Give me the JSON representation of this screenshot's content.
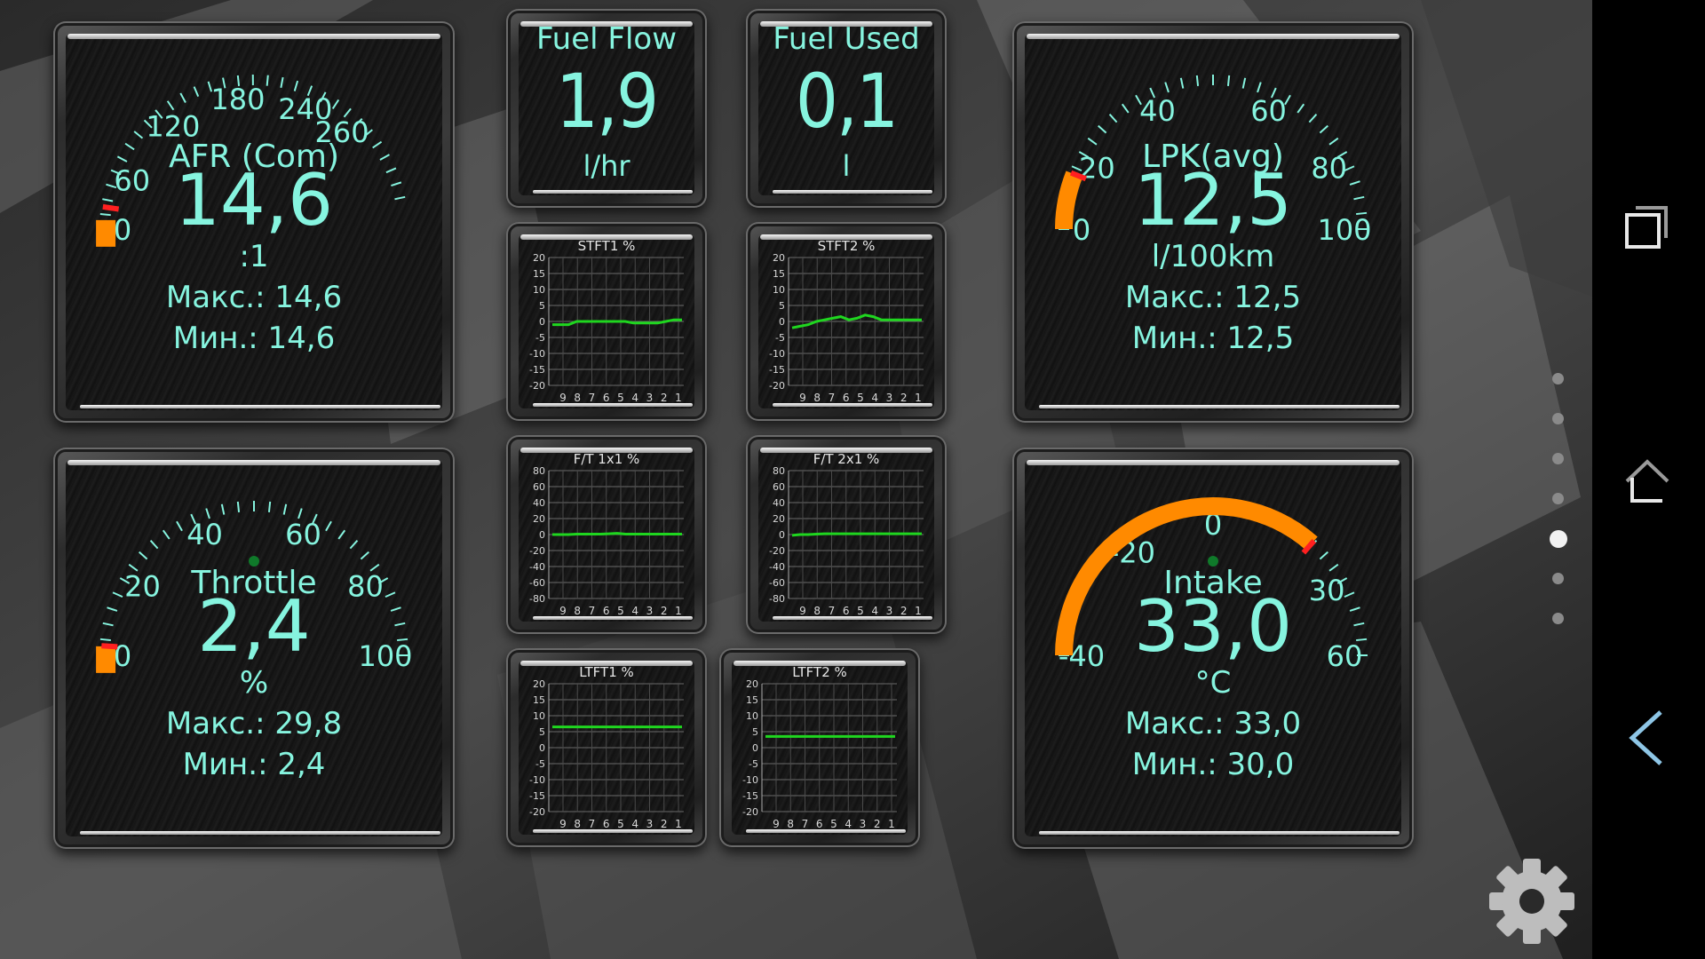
{
  "colors": {
    "text": "#86f4df",
    "needle": "#ff8a00",
    "trend": "#1fd61f",
    "tick": "#86f4df"
  },
  "gauges": [
    {
      "id": "afr",
      "label": "AFR (Com)",
      "value": "14,6",
      "unit": ":1",
      "max": "Макс.: 14,6",
      "min": "Мин.: 14,6",
      "ticks": [
        "0",
        "60",
        "120",
        "180",
        "240",
        "260"
      ],
      "level": 0.05
    },
    {
      "id": "lpk",
      "label": "LPK(avg)",
      "value": "12,5",
      "unit": "l/100km",
      "max": "Макс.: 12,5",
      "min": "Мин.: 12,5",
      "ticks": [
        "0",
        "20",
        "40",
        "60",
        "80",
        "100"
      ],
      "level": 0.12
    },
    {
      "id": "throttle",
      "label": "Throttle",
      "value": "2,4",
      "unit": "%",
      "max": "Макс.: 29,8",
      "min": "Мин.: 2,4",
      "ticks": [
        "0",
        "20",
        "40",
        "60",
        "80",
        "100"
      ],
      "level": 0.02
    },
    {
      "id": "intake",
      "label": "Intake",
      "value": "33,0",
      "unit": "°C",
      "max": "Макс.: 33,0",
      "min": "Мин.: 30,0",
      "ticks": [
        "-40",
        "-20",
        "0",
        "30",
        "60"
      ],
      "level": 0.73
    }
  ],
  "numeric": [
    {
      "label": "Fuel Flow",
      "value": "1,9",
      "unit": "l/hr"
    },
    {
      "label": "Fuel Used",
      "value": "0,1",
      "unit": "l"
    }
  ],
  "graphs": [
    {
      "title": "STFT1  %",
      "y_ticks": [
        "20",
        "15",
        "10",
        "5",
        "0",
        "-5",
        "-10",
        "-15",
        "-20"
      ],
      "y_range": [
        -20,
        20
      ],
      "x_ticks": [
        "9",
        "8",
        "7",
        "6",
        "5",
        "4",
        "3",
        "2",
        "1"
      ],
      "values": [
        -1,
        -1,
        -1,
        0,
        0,
        0,
        0,
        0,
        0,
        0,
        -0.5,
        -0.5,
        -0.5,
        -0.5,
        0,
        0.5,
        0.5
      ]
    },
    {
      "title": "STFT2  %",
      "y_ticks": [
        "20",
        "15",
        "10",
        "5",
        "0",
        "-5",
        "-10",
        "-15",
        "-20"
      ],
      "y_range": [
        -20,
        20
      ],
      "x_ticks": [
        "9",
        "8",
        "7",
        "6",
        "5",
        "4",
        "3",
        "2",
        "1"
      ],
      "values": [
        -2,
        -1.5,
        -1,
        0,
        0.5,
        1,
        1.5,
        0.5,
        1,
        2,
        1.5,
        0.5,
        0.5,
        0.5,
        0.5,
        0.5,
        0.5
      ]
    },
    {
      "title": "F/T 1x1  %",
      "y_ticks": [
        "80",
        "60",
        "40",
        "20",
        "0",
        "-20",
        "-40",
        "-60",
        "-80"
      ],
      "y_range": [
        -80,
        80
      ],
      "x_ticks": [
        "9",
        "8",
        "7",
        "6",
        "5",
        "4",
        "3",
        "2",
        "1"
      ],
      "values": [
        0,
        0,
        0,
        0.5,
        0.5,
        0.5,
        0.5,
        1,
        1.5,
        0.5,
        0.5,
        0.5,
        0.5,
        0.5,
        0.5,
        0.5,
        0.5
      ]
    },
    {
      "title": "F/T 2x1  %",
      "y_ticks": [
        "80",
        "60",
        "40",
        "20",
        "0",
        "-20",
        "-40",
        "-60",
        "-80"
      ],
      "y_range": [
        -80,
        80
      ],
      "x_ticks": [
        "9",
        "8",
        "7",
        "6",
        "5",
        "4",
        "3",
        "2",
        "1"
      ],
      "values": [
        -1,
        0,
        0,
        0.5,
        1,
        1,
        1,
        1,
        1,
        1,
        1,
        1,
        1,
        1,
        1,
        1,
        1
      ]
    },
    {
      "title": "LTFT1  %",
      "y_ticks": [
        "20",
        "15",
        "10",
        "5",
        "0",
        "-5",
        "-10",
        "-15",
        "-20"
      ],
      "y_range": [
        -20,
        20
      ],
      "x_ticks": [
        "9",
        "8",
        "7",
        "6",
        "5",
        "4",
        "3",
        "2",
        "1"
      ],
      "values": [
        6.5,
        6.5,
        6.5,
        6.5,
        6.5,
        6.5,
        6.5,
        6.5,
        6.5,
        6.5,
        6.5,
        6.5,
        6.5,
        6.5,
        6.5,
        6.5,
        6.5
      ]
    },
    {
      "title": "LTFT2  %",
      "y_ticks": [
        "20",
        "15",
        "10",
        "5",
        "0",
        "-5",
        "-10",
        "-15",
        "-20"
      ],
      "y_range": [
        -20,
        20
      ],
      "x_ticks": [
        "9",
        "8",
        "7",
        "6",
        "5",
        "4",
        "3",
        "2",
        "1"
      ],
      "values": [
        3.5,
        3.5,
        3.5,
        3.5,
        3.5,
        3.5,
        3.5,
        3.5,
        3.5,
        3.5,
        3.5,
        3.5,
        3.5,
        3.5,
        3.5,
        3.5,
        3.5
      ]
    }
  ],
  "nav": {
    "recent_icon": "recent-apps-icon",
    "home_icon": "home-icon",
    "back_icon": "back-icon",
    "settings_icon": "gear-icon",
    "page_count": 7,
    "active_page": 4
  }
}
